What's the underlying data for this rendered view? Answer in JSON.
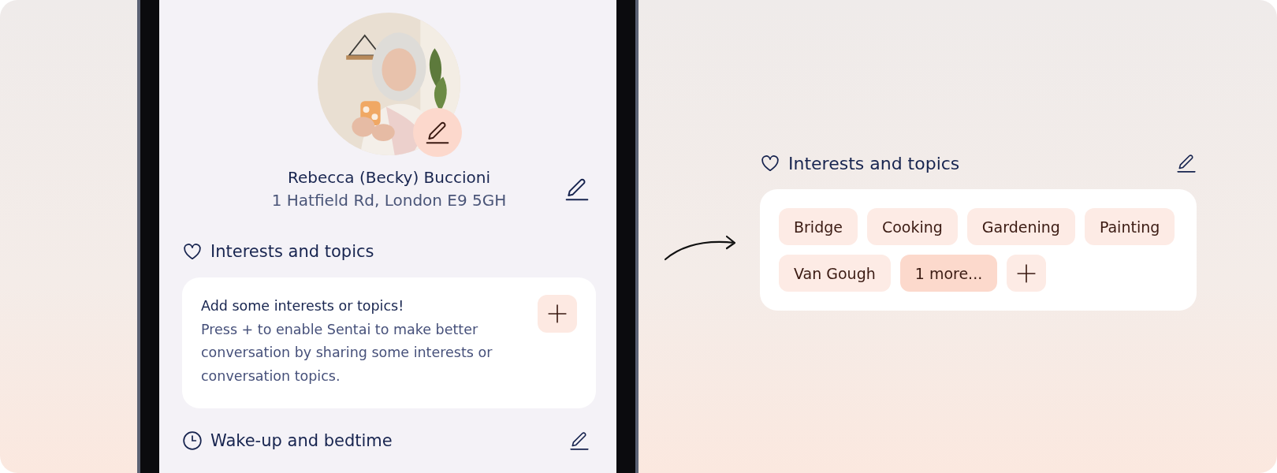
{
  "profile": {
    "name": "Rebecca (Becky) Buccioni",
    "address": "1 Hatfield Rd, London E9 5GH"
  },
  "interests_section": {
    "title": "Interests and topics",
    "empty_title": "Add some interests or topics!",
    "empty_text": "Press + to enable Sentai to make better conversation by sharing some interests or conversation topics."
  },
  "wake_section": {
    "title": "Wake-up and bedtime"
  },
  "interests_panel": {
    "title": "Interests and topics",
    "chips": [
      {
        "kind": "topic",
        "label": "Bridge"
      },
      {
        "kind": "topic",
        "label": "Cooking"
      },
      {
        "kind": "topic",
        "label": "Gardening"
      },
      {
        "kind": "topic",
        "label": "Painting"
      },
      {
        "kind": "topic",
        "label": "Van Gough"
      },
      {
        "kind": "more",
        "label": "1 more..."
      },
      {
        "kind": "add"
      }
    ]
  }
}
